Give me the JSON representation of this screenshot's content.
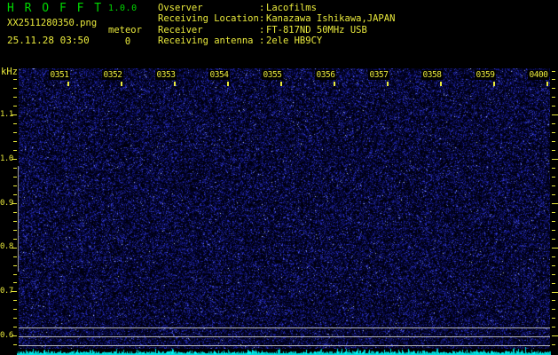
{
  "app": {
    "title": "H R O F F T",
    "version": "1.0.0"
  },
  "file": {
    "name": "XX2511280350.png",
    "timestamp": "25.11.28 03:50"
  },
  "meteor": {
    "label": "meteor",
    "count": "0"
  },
  "station": {
    "separator": ":",
    "rows": [
      {
        "label": "Ovserver",
        "value": "Lacofilms"
      },
      {
        "label": "Receiving Location",
        "value": "Kanazawa Ishikawa,JAPAN"
      },
      {
        "label": "Receiver",
        "value": "FT-817ND 50MHz USB"
      },
      {
        "label": "Receiving antenna",
        "value": "2ele HB9CY"
      }
    ]
  },
  "spectrogram": {
    "unit_label": "kHz",
    "freq_labels": [
      "1.1",
      "1.0",
      "0.9",
      "0.8",
      "0.7",
      "0.6"
    ],
    "time_labels": [
      "0351",
      "0352",
      "0353",
      "0354",
      "0355",
      "0356",
      "0357",
      "0358",
      "0359",
      "0400"
    ],
    "colors": {
      "title_green": "#00d800",
      "text_yellow": "#eaea3c",
      "noise_blue": "#2228b4",
      "reference_gray": "#b4b4b4",
      "level_cyan": "#00e0e0",
      "background": "#000000"
    }
  }
}
